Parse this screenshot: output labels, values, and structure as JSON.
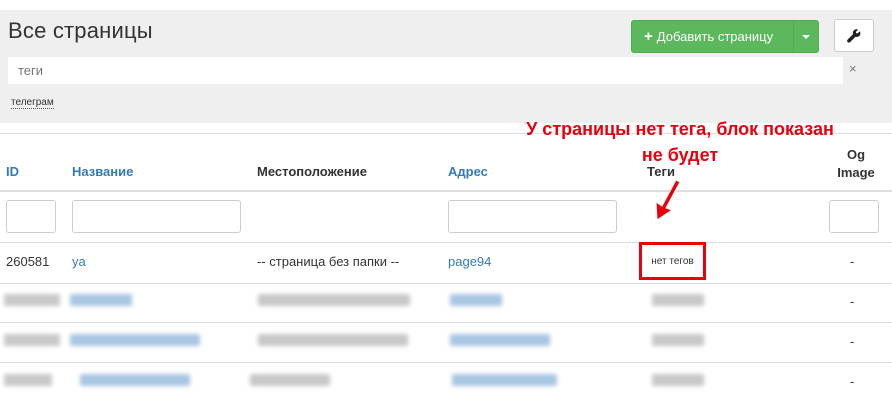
{
  "header": {
    "title": "Все страницы",
    "add_button": "Добавить страницу",
    "add_icon": "plus-icon",
    "tool_icon": "wrench-icon"
  },
  "search": {
    "placeholder": "теги",
    "clear": "×",
    "tag": "телеграм"
  },
  "table": {
    "columns": {
      "id": "ID",
      "name": "Название",
      "location": "Местоположение",
      "address": "Адрес",
      "tags": "Теги",
      "og_line1": "Og",
      "og_line2": "Image"
    },
    "row": {
      "id": "260581",
      "name": "ya",
      "location": "-- страница без папки --",
      "address": "page94",
      "tags": "нет тегов",
      "og": "-"
    },
    "dash": "-"
  },
  "annotation": {
    "line1": "У страницы нет тега, блок показан",
    "line2": "не будет"
  },
  "colors": {
    "accent_green": "#5cb85c",
    "link_blue": "#337ab7",
    "annotation_red": "#e8000d"
  }
}
